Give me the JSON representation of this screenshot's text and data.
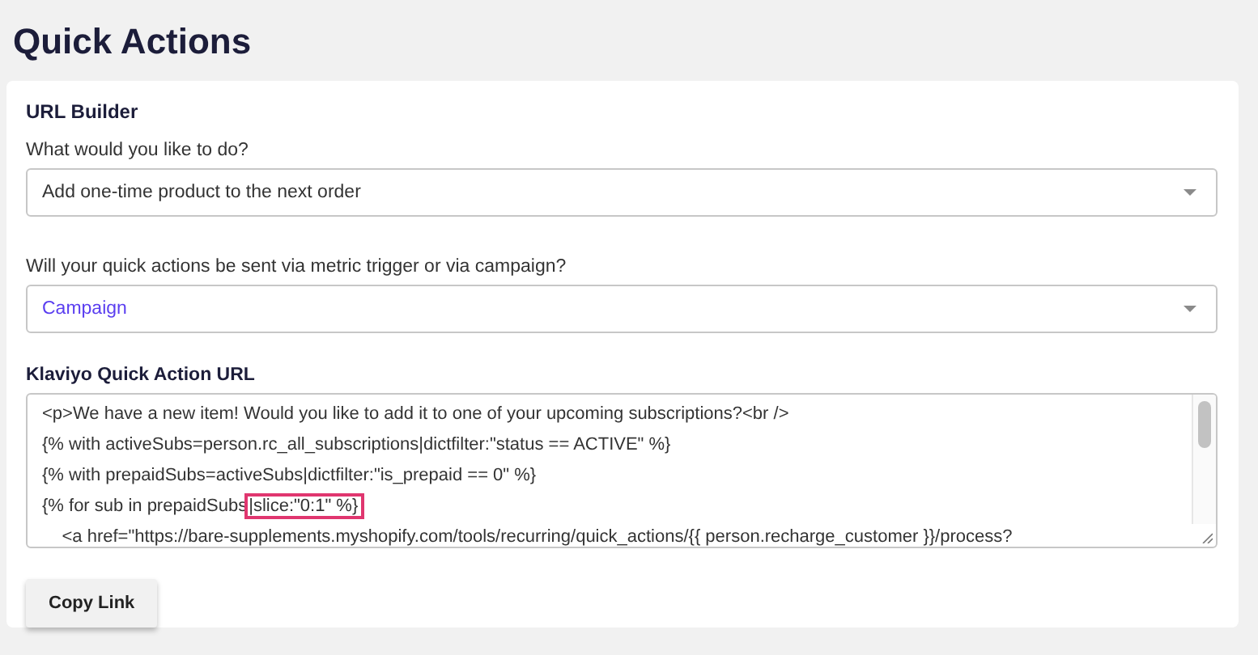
{
  "page_title": "Quick Actions",
  "section_title": "URL Builder",
  "selects": [
    {
      "label": "What would you like to do?",
      "value": "Add one-time product to the next order",
      "kind": "plain"
    },
    {
      "label": "Will your quick actions be sent via metric trigger or via campaign?",
      "value": "Campaign",
      "kind": "accent"
    }
  ],
  "url_label": "Klaviyo Quick Action URL",
  "code_lines": [
    {
      "text": "<p>We have a new item! Would you like to add it to one of your upcoming subscriptions?<br />"
    },
    {
      "text": "{% with activeSubs=person.rc_all_subscriptions|dictfilter:\"status == ACTIVE\" %}"
    },
    {
      "text": "{% with prepaidSubs=activeSubs|dictfilter:\"is_prepaid == 0\" %}"
    },
    {
      "text": "{% for sub in prepaidSubs",
      "highlight": "|slice:\"0:1\" %}"
    },
    {
      "text": "    <a href=\"https://bare-supplements.myshopify.com/tools/recurring/quick_actions/{{ person.recharge_customer }}/process?"
    }
  ],
  "button": "Copy Link"
}
